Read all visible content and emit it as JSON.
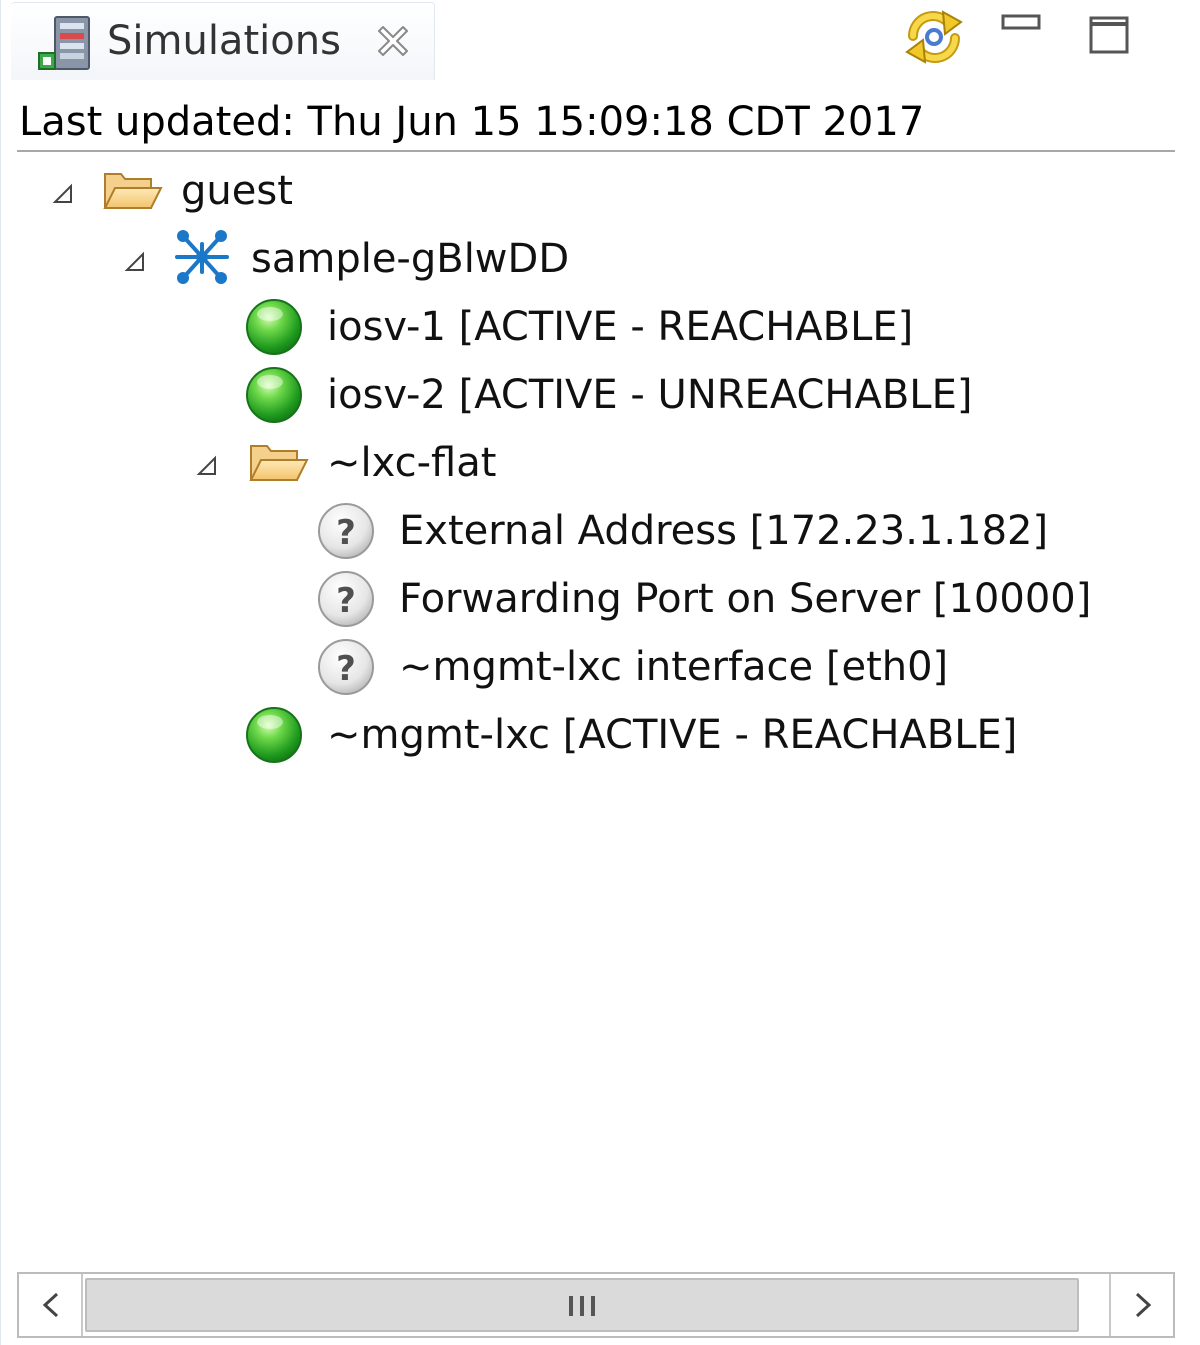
{
  "tab": {
    "title": "Simulations",
    "icon": "server-icon",
    "close_icon": "close-icon"
  },
  "toolbar": {
    "icons": [
      "sync-icon",
      "minimize-icon",
      "maximize-icon"
    ]
  },
  "status": {
    "last_updated": "Last updated: Thu Jun 15 15:09:18 CDT 2017"
  },
  "tree": {
    "nodes": [
      {
        "label": "guest",
        "icon": "folder-open-icon",
        "expanded": true,
        "level": 0
      },
      {
        "label": "sample-gBlwDD",
        "icon": "network-topology-icon",
        "expanded": true,
        "level": 1
      },
      {
        "label": "iosv-1  [ACTIVE - REACHABLE]",
        "icon": "status-green-icon",
        "level": 2
      },
      {
        "label": "iosv-2  [ACTIVE - UNREACHABLE]",
        "icon": "status-green-icon",
        "level": 2
      },
      {
        "label": "~lxc-flat",
        "icon": "folder-open-icon",
        "expanded": true,
        "level": 2
      },
      {
        "label": "External Address  [172.23.1.182]",
        "icon": "unknown-status-icon",
        "level": 3
      },
      {
        "label": "Forwarding Port on Server  [10000]",
        "icon": "unknown-status-icon",
        "level": 3
      },
      {
        "label": "~mgmt-lxc interface  [eth0]",
        "icon": "unknown-status-icon",
        "level": 3
      },
      {
        "label": "~mgmt-lxc  [ACTIVE - REACHABLE]",
        "icon": "status-green-icon",
        "level": 2
      }
    ]
  },
  "colors": {
    "status_active": "#2fb52f",
    "folder": "#f5c878",
    "network": "#1b78c8",
    "rule": "#a8a8a8"
  }
}
